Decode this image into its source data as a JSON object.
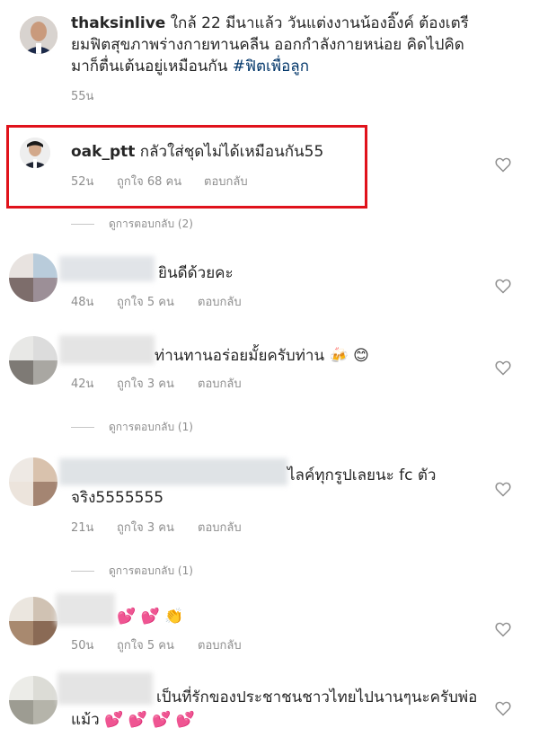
{
  "post": {
    "username": "thaksinlive",
    "caption_line1": "ใกล้ 22 มีนาแล้ว วันแต่งงานน้องอิ๊งค์ ต้องเตรี",
    "caption_line2": "ยมฟิตสุขภาพร่างกายทานคลีน ออกกำลังกายหน่อย คิดไปคิด",
    "caption_line3": "มาก็ตื่นเต้นอยู่เหมือนกัน",
    "hashtag": "#ฟิตเพื่อลูก",
    "time": "55น"
  },
  "comments": [
    {
      "username": "oak_ptt",
      "text": "กลัวใส่ชุดไม่ได้เหมือนกัน55",
      "time": "52น",
      "likes": "ถูกใจ 68 คน",
      "reply": "ตอบกลับ",
      "view_replies": "ดูการตอบกลับ (2)"
    },
    {
      "text": "ยินดีด้วยคะ",
      "time": "48น",
      "likes": "ถูกใจ 5 คน",
      "reply": "ตอบกลับ"
    },
    {
      "text": "ท่านทานอร่อยมั้ยครับท่าน",
      "emoji": "🍻 😊",
      "time": "42น",
      "likes": "ถูกใจ 3 คน",
      "reply": "ตอบกลับ",
      "view_replies": "ดูการตอบกลับ (1)"
    },
    {
      "text_line1": "ไลค์ทุกรูปเลยนะ fc ตัว",
      "text_line2": "จริง5555555",
      "time": "21น",
      "likes": "ถูกใจ 3 คน",
      "reply": "ตอบกลับ",
      "view_replies": "ดูการตอบกลับ (1)"
    },
    {
      "emoji": "💕 💕 👏",
      "time": "50น",
      "likes": "ถูกใจ 5 คน",
      "reply": "ตอบกลับ"
    },
    {
      "text_line1": "เป็นที่รักของประชาชนชาวไทยไปนานๆนะครับพ่อ",
      "text_line2": "แม้ว",
      "emoji": "💕 💕 💕 💕"
    }
  ],
  "icons": {
    "heart": "heart-outline-icon"
  },
  "colors": {
    "highlight": "#e0121b",
    "hashtag": "#003569",
    "meta": "#8e8e8e"
  }
}
